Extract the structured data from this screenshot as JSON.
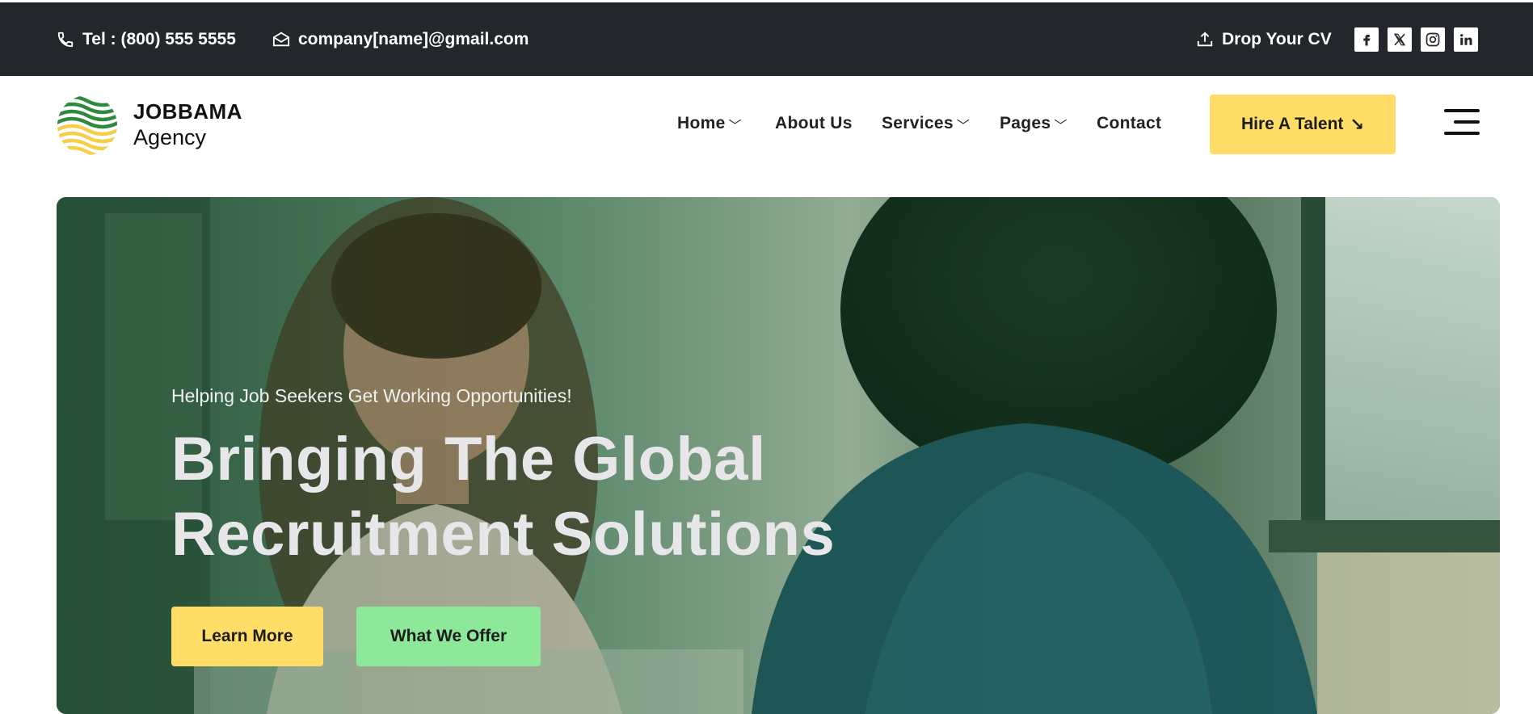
{
  "topbar": {
    "phone": "Tel : (800) 555 5555",
    "email": "company[name]@gmail.com",
    "cv": "Drop Your CV",
    "social": [
      "facebook-icon",
      "x-icon",
      "instagram-icon",
      "linkedin-icon"
    ]
  },
  "brand": {
    "name": "JOBBAMA",
    "sub": "Agency"
  },
  "nav": {
    "home": "Home",
    "about": "About Us",
    "services": "Services",
    "pages": "Pages",
    "contact": "Contact",
    "chevron": "﹀"
  },
  "header": {
    "hire_label": "Hire A Talent",
    "hire_arrow": "↘"
  },
  "hero": {
    "subtitle": "Helping Job Seekers Get Working Opportunities!",
    "title_line1": "Bringing The Global",
    "title_line2": "Recruitment Solutions",
    "learn_more": "Learn More",
    "what_we_offer": "What We Offer"
  },
  "colors": {
    "topbar_bg": "#23262b",
    "accent_yellow": "#ffdd66",
    "accent_green": "#8de89a",
    "logo_green": "#2e8b3d",
    "logo_yellow": "#f5cf4a"
  }
}
